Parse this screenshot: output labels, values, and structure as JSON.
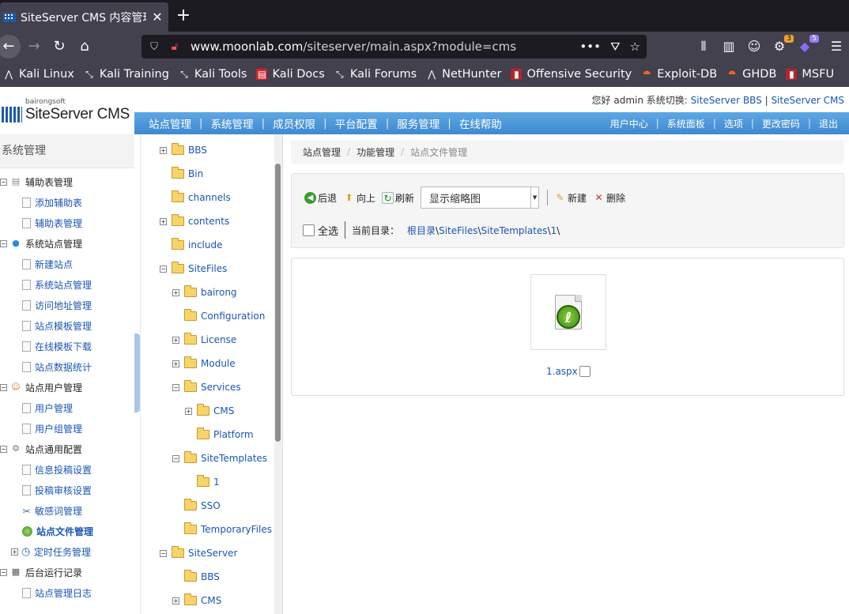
{
  "browser": {
    "tab_title": "SiteServer CMS 内容管理",
    "url_host": "www.moonlab.com",
    "url_path": "/siteserver/main.aspx?module=cms",
    "badge_extensions_1": "3",
    "badge_extensions_2": "5"
  },
  "bookmarks": [
    {
      "label": "Kali Linux"
    },
    {
      "label": "Kali Training"
    },
    {
      "label": "Kali Tools"
    },
    {
      "label": "Kali Docs"
    },
    {
      "label": "Kali Forums"
    },
    {
      "label": "NetHunter"
    },
    {
      "label": "Offensive Security"
    },
    {
      "label": "Exploit-DB"
    },
    {
      "label": "GHDB"
    },
    {
      "label": "MSFU"
    }
  ],
  "header": {
    "logo_small": "bairongsoft",
    "logo_main": "SiteServer CMS",
    "greeting_prefix": "您好 admin  系统切换:",
    "switch_bbs": "SiteServer BBS",
    "switch_sep": "|",
    "switch_cms": "SiteServer CMS"
  },
  "topnav": {
    "left": [
      "站点管理",
      "系统管理",
      "成员权限",
      "平台配置",
      "服务管理",
      "在线帮助"
    ],
    "right": [
      "用户中心",
      "系统面板",
      "选项",
      "更改密码",
      "退出"
    ],
    "sep": "|"
  },
  "sidebar": {
    "title": "系统管理",
    "items": [
      {
        "label": "辅助表管理",
        "level": 1,
        "expander": "−",
        "icon": "table-icon"
      },
      {
        "label": "添加辅助表",
        "level": 2
      },
      {
        "label": "辅助表管理",
        "level": 2
      },
      {
        "label": "系统站点管理",
        "level": 1,
        "expander": "−",
        "icon": "globe-icon"
      },
      {
        "label": "新建站点",
        "level": 2
      },
      {
        "label": "系统站点管理",
        "level": 2
      },
      {
        "label": "访问地址管理",
        "level": 2
      },
      {
        "label": "站点模板管理",
        "level": 2
      },
      {
        "label": "在线模板下载",
        "level": 2
      },
      {
        "label": "站点数据统计",
        "level": 2
      },
      {
        "label": "站点用户管理",
        "level": 1,
        "expander": "−",
        "icon": "user-icon"
      },
      {
        "label": "用户管理",
        "level": 2
      },
      {
        "label": "用户组管理",
        "level": 2
      },
      {
        "label": "站点通用配置",
        "level": 1,
        "expander": "−",
        "icon": "gear-icon"
      },
      {
        "label": "信息投稿设置",
        "level": 2
      },
      {
        "label": "投稿审核设置",
        "level": 2
      },
      {
        "label": "敏感词管理",
        "level": 2
      },
      {
        "label": "站点文件管理",
        "level": 2,
        "active": true
      },
      {
        "label": "定时任务管理",
        "level": 2,
        "expander": "+"
      },
      {
        "label": "后台运行记录",
        "level": 1,
        "expander": "−",
        "icon": "log-icon"
      },
      {
        "label": "站点管理日志",
        "level": 2
      }
    ]
  },
  "tree": [
    {
      "label": "BBS",
      "depth": 0,
      "exp": "+"
    },
    {
      "label": "Bin",
      "depth": 0,
      "exp": ""
    },
    {
      "label": "channels",
      "depth": 0,
      "exp": ""
    },
    {
      "label": "contents",
      "depth": 0,
      "exp": "+"
    },
    {
      "label": "include",
      "depth": 0,
      "exp": ""
    },
    {
      "label": "SiteFiles",
      "depth": 0,
      "exp": "−"
    },
    {
      "label": "bairong",
      "depth": 1,
      "exp": "+"
    },
    {
      "label": "Configuration",
      "depth": 1,
      "exp": ""
    },
    {
      "label": "License",
      "depth": 1,
      "exp": "+"
    },
    {
      "label": "Module",
      "depth": 1,
      "exp": "+"
    },
    {
      "label": "Services",
      "depth": 1,
      "exp": "−"
    },
    {
      "label": "CMS",
      "depth": 2,
      "exp": "+"
    },
    {
      "label": "Platform",
      "depth": 2,
      "exp": ""
    },
    {
      "label": "SiteTemplates",
      "depth": 1,
      "exp": "−"
    },
    {
      "label": "1",
      "depth": 2,
      "exp": ""
    },
    {
      "label": "SSO",
      "depth": 1,
      "exp": ""
    },
    {
      "label": "TemporaryFiles",
      "depth": 1,
      "exp": ""
    },
    {
      "label": "SiteServer",
      "depth": 0,
      "exp": "−"
    },
    {
      "label": "BBS",
      "depth": 1,
      "exp": ""
    },
    {
      "label": "CMS",
      "depth": 1,
      "exp": "+"
    }
  ],
  "breadcrumb": {
    "item1": "站点管理",
    "item2": "功能管理",
    "current": "站点文件管理",
    "sep": "/"
  },
  "toolbar": {
    "back": "后退",
    "up": "向上",
    "refresh": "刷新",
    "view_select": "显示缩略图",
    "new": "新建",
    "delete": "删除",
    "select_all": "全选",
    "current_dir_label": "当前目录：",
    "path_root": "根目录",
    "path_parts": [
      "SiteFiles",
      "SiteTemplates",
      "1"
    ]
  },
  "files": [
    {
      "name": "1.aspx"
    }
  ]
}
